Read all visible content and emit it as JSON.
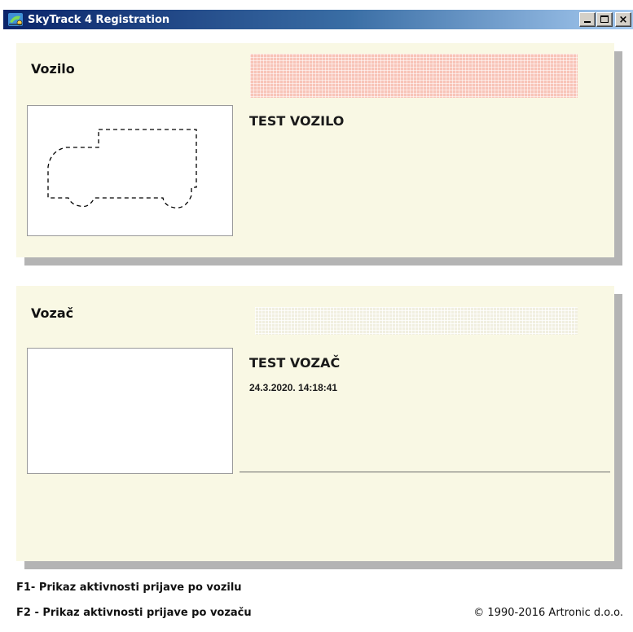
{
  "window": {
    "title": "SkyTrack 4 Registration",
    "controls": {
      "minimize_icon": "minimize-icon",
      "maximize_icon": "maximize-icon",
      "close_icon": "close-icon",
      "close_glyph": "×"
    }
  },
  "vehicle": {
    "heading": "Vozilo",
    "name": "TEST VOZILO",
    "photo_icon": "truck-outline-icon",
    "plate_color": "#f8c4b8"
  },
  "driver": {
    "heading": "Vozač",
    "name": "TEST VOZAČ",
    "datetime": "24.3.2020. 14:18:41"
  },
  "footer": {
    "hint_f1": "F1- Prikaz aktivnosti prijave po vozilu",
    "hint_f2": "F2 - Prikaz aktivnosti prijave po vozaču",
    "copyright": "© 1990-2016 Artronic d.o.o."
  },
  "colors": {
    "panel_bg": "#f9f8e4",
    "panel_shadow": "#b4b4b4",
    "titlebar_start": "#0a246a",
    "titlebar_end": "#a6caf0"
  }
}
